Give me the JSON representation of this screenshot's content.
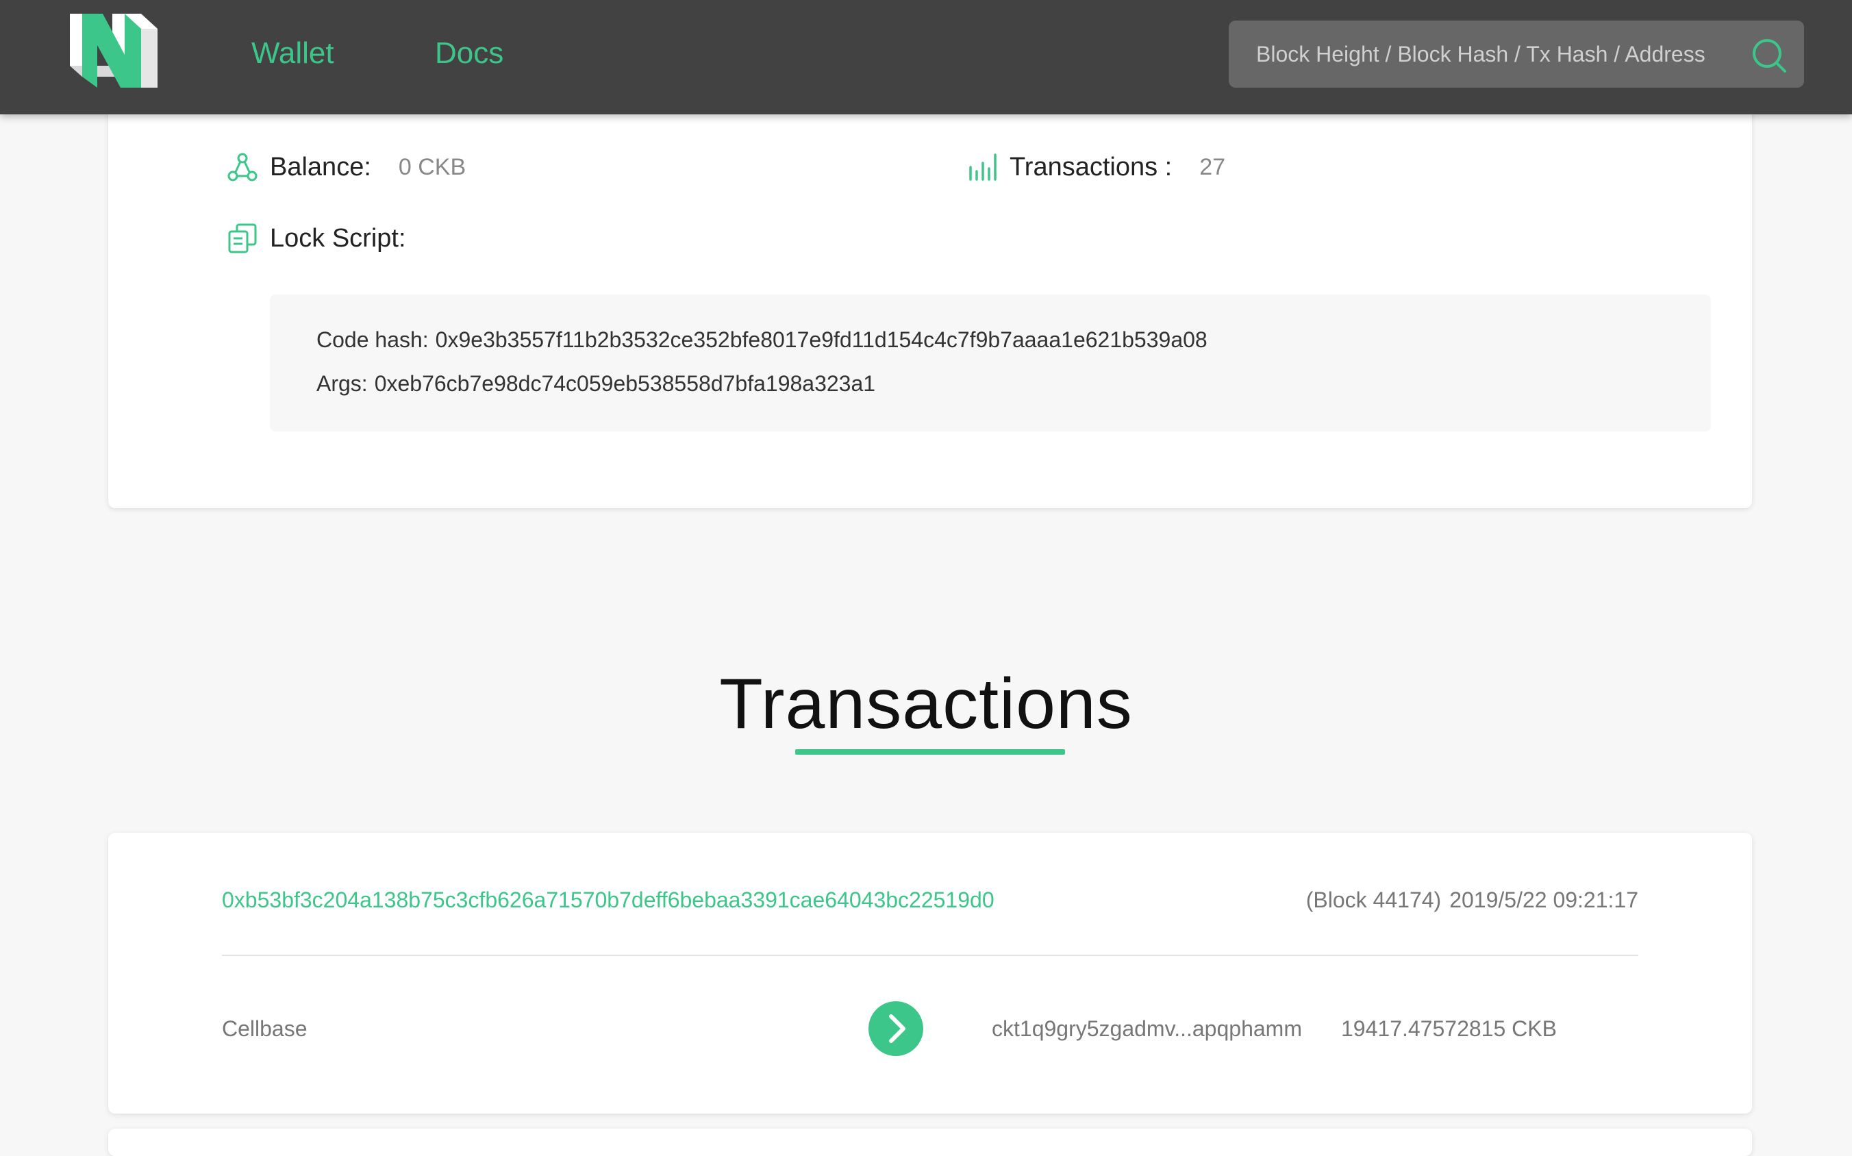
{
  "header": {
    "logo_icon": "nervos-logo-icon",
    "nav": [
      {
        "label": "Wallet"
      },
      {
        "label": "Docs"
      }
    ],
    "search": {
      "placeholder": "Block Height / Block Hash / Tx Hash / Address",
      "value": "",
      "icon": "search-icon"
    },
    "accent_color": "#3cc68a",
    "background_color": "#424242"
  },
  "address_info": {
    "balance": {
      "icon": "balance-icon",
      "label": "Balance:",
      "value": "0 CKB"
    },
    "transactions": {
      "icon": "bar-chart-icon",
      "label": "Transactions :",
      "value": "27"
    },
    "lock_script": {
      "icon": "lock-script-icon",
      "label": "Lock Script:",
      "code_hash_label": "Code hash:",
      "code_hash": "0x9e3b3557f11b2b3532ce352bfe8017e9fd11d154c4c7f9b7aaaa1e621b539a08",
      "args_label": "Args:",
      "args": "0xeb76cb7e98dc74c059eb538558d7bfa198a323a1"
    }
  },
  "transactions_section": {
    "title": "Transactions",
    "items": [
      {
        "hash": "0xb53bf3c204a138b75c3cfb626a71570b7deff6bebaa3391cae64043bc22519d0",
        "block": "(Block 44174)",
        "timestamp": "2019/5/22 09:21:17",
        "input": "Cellbase",
        "arrow_icon": "arrow-right-circle-icon",
        "output_address": "ckt1q9gry5zgadmv...apqphamm",
        "output_amount": "19417.47572815 CKB"
      }
    ]
  }
}
